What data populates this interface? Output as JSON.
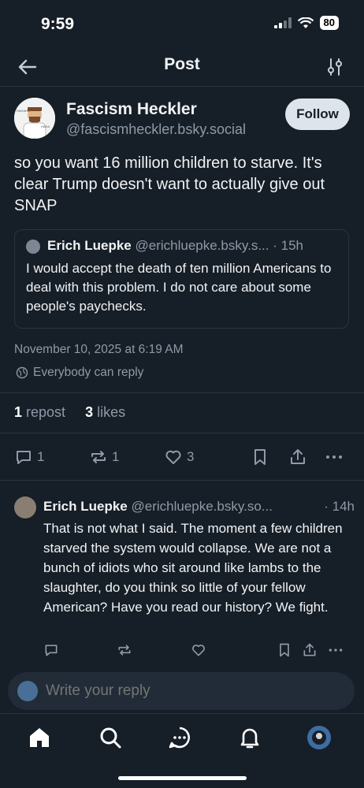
{
  "status": {
    "time": "9:59",
    "battery": "80"
  },
  "header": {
    "title": "Post"
  },
  "post": {
    "author_name": "Fascism Heckler",
    "author_handle": "@fascismheckler.bsky.social",
    "follow_label": "Follow",
    "text": "so you want 16 million children to starve. It's clear Trump doesn't want to actually give out SNAP",
    "quote": {
      "author_name": "Erich Luepke",
      "author_handle": "@erichluepke.bsky.s...",
      "time": "· 15h",
      "text": "I would accept the death of ten million Americans to deal with this problem. I do not care about some people's paychecks."
    },
    "timestamp": "November 10, 2025 at 6:19 AM",
    "reply_setting": "Everybody can reply",
    "stats": {
      "reposts_count": "1",
      "reposts_label": "repost",
      "likes_count": "3",
      "likes_label": "likes"
    },
    "actions": {
      "replies": "1",
      "reposts": "1",
      "likes": "3"
    }
  },
  "reply": {
    "author_name": "Erich Luepke",
    "author_handle": "@erichluepke.bsky.so...",
    "time": "· 14h",
    "text": "That is not what I said. The moment a few children starved the system would collapse. We are not a bunch of idiots who sit around like lambs to the slaughter, do you think so little of your fellow American? Have you read our history? We fight."
  },
  "composer": {
    "placeholder": "Write your reply"
  },
  "colors": {
    "background": "#161e27",
    "muted": "#8e9aa8",
    "border": "#2a3542"
  },
  "icons": [
    "back-arrow-icon",
    "filter-icon",
    "reply-icon",
    "repost-icon",
    "heart-icon",
    "bookmark-icon",
    "share-icon",
    "more-icon",
    "home-icon",
    "search-icon",
    "chat-icon",
    "bell-icon"
  ]
}
